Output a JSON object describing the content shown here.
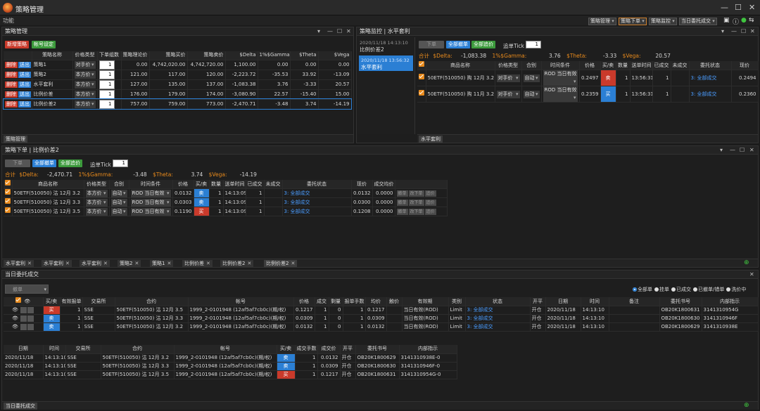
{
  "app": {
    "title": "策略管理",
    "menu": "功能"
  },
  "toolbar": [
    {
      "label": "策略管理",
      "active": false
    },
    {
      "label": "策略下单",
      "active": true
    },
    {
      "label": "策略监控",
      "active": false
    },
    {
      "label": "当日委托成交",
      "active": false
    }
  ],
  "strategy_mgmt": {
    "title": "策略管理",
    "btn_new": "新增策略",
    "btn_account": "帐号设定",
    "headers": [
      "",
      "策略名称",
      "价格类型",
      "下单组数",
      "策略理论价",
      "策略买价",
      "策略卖价",
      "$Delta",
      "1%$Gamma",
      "$Theta",
      "$Vega"
    ],
    "row_btn_del": "删除",
    "row_btn_send": "送出",
    "rows": [
      {
        "name": "策略1",
        "ptype": "对手价",
        "qty": "1",
        "theo": "0.00",
        "bid": "4,742,020.00",
        "ask": "4,742,720.00",
        "delta": "1,100.00",
        "gamma": "0.00",
        "theta": "0.00",
        "vega": "0.00"
      },
      {
        "name": "策略2",
        "ptype": "本方价",
        "qty": "1",
        "theo": "121.00",
        "bid": "117.00",
        "ask": "120.00",
        "delta": "-2,223.72",
        "gamma": "-35.53",
        "theta": "33.92",
        "vega": "-13.09"
      },
      {
        "name": "水平套利",
        "ptype": "本方价",
        "qty": "1",
        "theo": "127.00",
        "bid": "135.00",
        "ask": "137.00",
        "delta": "-1,083.38",
        "gamma": "3.76",
        "theta": "-3.33",
        "vega": "20.57"
      },
      {
        "name": "比例价差",
        "ptype": "本方价",
        "qty": "1",
        "theo": "176.00",
        "bid": "179.00",
        "ask": "174.00",
        "delta": "-3,080.90",
        "gamma": "22.57",
        "theta": "-15.40",
        "vega": "15.00"
      },
      {
        "name": "比例价差2",
        "ptype": "本方价",
        "qty": "1",
        "theo": "757.00",
        "bid": "759.00",
        "ask": "773.00",
        "delta": "-2,470.71",
        "gamma": "-3.48",
        "theta": "3.74",
        "vega": "-14.19"
      }
    ],
    "tab": "策略管理"
  },
  "monitor": {
    "title": "策略监控 | 水平套利",
    "list": [
      {
        "time": "2020/11/18 14:13:10",
        "name": "比例价差2"
      },
      {
        "time": "2020/11/18 13:56:32",
        "name": "水平套利"
      }
    ],
    "btn_order": "下单",
    "btn_cancel": "全部撤单",
    "btn_chase": "全部追价",
    "tick_label": "追单Tick",
    "tick_value": "1",
    "sum_label": "合计",
    "delta_label": "$Delta:",
    "delta": "-1,083.38",
    "gamma_label": "1%$Gamma:",
    "gamma": "3.76",
    "theta_label": "$Theta:",
    "theta": "-3.33",
    "vega_label": "$Vega:",
    "vega": "20.57",
    "headers": [
      "",
      "商品名称",
      "价格类型",
      "合别",
      "时间条件",
      "价格",
      "买/卖",
      "数量",
      "送单时间",
      "已成交",
      "未成交",
      "委托状态",
      "现价"
    ],
    "rows": [
      {
        "product": "50ETF(510050) 购 12月 3.2",
        "ptype": "对手价",
        "combo": "自动",
        "tc": "ROD 当日有效",
        "price": "0.2497",
        "side": "卖",
        "sidecls": "buy",
        "qty": "1",
        "time": "13:56:31",
        "filled": "1",
        "unfilled": "",
        "status": "3: 全部成交",
        "last": "0.2494"
      },
      {
        "product": "50ETF(510050) 购 11月 3.2",
        "ptype": "对手价",
        "combo": "自动",
        "tc": "ROD 当日有效",
        "price": "0.2359",
        "side": "买",
        "sidecls": "sell",
        "qty": "1",
        "time": "13:56:31",
        "filled": "1",
        "unfilled": "",
        "status": "3: 全部成交",
        "last": "0.2360"
      }
    ],
    "tab": "水平套利"
  },
  "order": {
    "title": "策略下单 | 比例价差2",
    "btn_order": "下单",
    "btn_cancel": "全部撤单",
    "btn_chase": "全部追价",
    "tick_label": "追单Tick",
    "tick_value": "1",
    "sum_label": "合计",
    "delta_label": "$Delta:",
    "delta": "-2,470.71",
    "gamma_label": "1%$Gamma:",
    "gamma": "-3.48",
    "theta_label": "$Theta:",
    "theta": "3.74",
    "vega_label": "$Vega:",
    "vega": "-14.19",
    "headers": [
      "",
      "商品名称",
      "价格类型",
      "合别",
      "时间条件",
      "价格",
      "买/卖",
      "数量",
      "送单时间",
      "已成交",
      "未成交",
      "委托状态",
      "现价",
      "成交均价",
      ""
    ],
    "row_btns": [
      "撤单",
      "改下单",
      "追价"
    ],
    "rows": [
      {
        "product": "50ETF(510050) 沽 12月 3.2",
        "ptype": "本方价",
        "combo": "自动",
        "tc": "ROD 当日有效",
        "price": "0.0132",
        "side": "卖",
        "sidecls": "sell",
        "qty": "1",
        "time": "14:13:09",
        "filled": "1",
        "unfilled": "",
        "status": "3: 全部成交",
        "last": "0.0132",
        "avg": "0.0000"
      },
      {
        "product": "50ETF(510050) 沽 12月 3.3",
        "ptype": "本方价",
        "combo": "自动",
        "tc": "ROD 当日有效",
        "price": "0.0303",
        "side": "卖",
        "sidecls": "sell",
        "qty": "1",
        "time": "14:13:09",
        "filled": "1",
        "unfilled": "",
        "status": "3: 全部成交",
        "last": "0.0300",
        "avg": "0.0000"
      },
      {
        "product": "50ETF(510050) 沽 12月 3.5",
        "ptype": "本方价",
        "combo": "自动",
        "tc": "ROD 当日有效",
        "price": "0.1190",
        "side": "买",
        "sidecls": "buy",
        "qty": "1",
        "time": "14:13:09",
        "filled": "1",
        "unfilled": "",
        "status": "3: 全部成交",
        "last": "0.1208",
        "avg": "0.0000"
      }
    ],
    "tabs": [
      "水平套利",
      "水平套利",
      "水平套利",
      "策略2",
      "策略1",
      "比例价差",
      "比例价差2",
      "比例价差2"
    ]
  },
  "today": {
    "title": "当日委托成交",
    "btn_cancel": "撤单",
    "filters": [
      "全部单",
      "挂单",
      "已成交",
      "已撤单/错单",
      "洗价中"
    ],
    "headers": [
      "",
      "买/卖",
      "有效报单",
      "交易所",
      "合约",
      "帐号",
      "价格",
      "成交",
      "剩量",
      "报单手数",
      "均价",
      "触价",
      "有效期",
      "类别",
      "状态",
      "开平",
      "日期",
      "时间",
      "备注",
      "委托书号",
      "内部指示"
    ],
    "rows": [
      {
        "side": "买",
        "sidecls": "buy",
        "valid": "1",
        "ex": "SSE",
        "contract": "50ETF(510050) 沽 12月 3.5",
        "acct": "1999_2-0101948 (12af5af7cb0c)(期/权)",
        "price": "0.1217",
        "filled": "1",
        "left": "0",
        "lots": "1",
        "avg": "0.1217",
        "trig": "",
        "exp": "当日有效(ROD)",
        "type": "Limit",
        "status": "3: 全部成交",
        "oc": "开仓",
        "date": "2020/11/18",
        "time": "14:13:10",
        "note": "",
        "ono": "OB20K1800631",
        "inner": "3141310954G"
      },
      {
        "side": "卖",
        "sidecls": "sell",
        "valid": "1",
        "ex": "SSE",
        "contract": "50ETF(510050) 沽 12月 3.3",
        "acct": "1999_2-0101948 (12af5af7cb0c)(期/权)",
        "price": "0.0309",
        "filled": "1",
        "left": "0",
        "lots": "1",
        "avg": "0.0309",
        "trig": "",
        "exp": "当日有效(ROD)",
        "type": "Limit",
        "status": "3: 全部成交",
        "oc": "开仓",
        "date": "2020/11/18",
        "time": "14:13:10",
        "note": "",
        "ono": "OB20K1800630",
        "inner": "3141310946F"
      },
      {
        "side": "卖",
        "sidecls": "sell",
        "valid": "1",
        "ex": "SSE",
        "contract": "50ETF(510050) 沽 12月 3.2",
        "acct": "1999_2-0101948 (12af5af7cb0c)(期/权)",
        "price": "0.0132",
        "filled": "1",
        "left": "0",
        "lots": "1",
        "avg": "0.0132",
        "trig": "",
        "exp": "当日有效(ROD)",
        "type": "Limit",
        "status": "3: 全部成交",
        "oc": "开仓",
        "date": "2020/11/18",
        "time": "14:13:10",
        "note": "",
        "ono": "OB20K1800629",
        "inner": "3141310938E"
      }
    ],
    "fill_headers": [
      "日期",
      "时间",
      "交易所",
      "合约",
      "帐号",
      "买/卖",
      "成交手数",
      "成交价",
      "开平",
      "委托书号",
      "内部指示"
    ],
    "fills": [
      {
        "date": "2020/11/18",
        "time": "14:13:10",
        "ex": "SSE",
        "contract": "50ETF(510050) 沽 12月 3.2",
        "acct": "1999_2-0101948 (12af5af7cb0c)(期/权)",
        "side": "卖",
        "sidecls": "sell",
        "lots": "1",
        "price": "0.0132",
        "oc": "开仓",
        "ono": "OB20K1800629",
        "inner": "3141310938E-0"
      },
      {
        "date": "2020/11/18",
        "time": "14:13:10",
        "ex": "SSE",
        "contract": "50ETF(510050) 沽 12月 3.3",
        "acct": "1999_2-0101948 (12af5af7cb0c)(期/权)",
        "side": "卖",
        "sidecls": "sell",
        "lots": "1",
        "price": "0.0309",
        "oc": "开仓",
        "ono": "OB20K1800630",
        "inner": "3141310946F-0"
      },
      {
        "date": "2020/11/18",
        "time": "14:13:10",
        "ex": "SSE",
        "contract": "50ETF(510050) 沽 12月 3.5",
        "acct": "1999_2-0101948 (12af5af7cb0c)(期/权)",
        "side": "买",
        "sidecls": "buy",
        "lots": "1",
        "price": "0.1217",
        "oc": "开仓",
        "ono": "OB20K1800631",
        "inner": "3141310954G-0"
      }
    ],
    "tab": "当日委托成交"
  }
}
